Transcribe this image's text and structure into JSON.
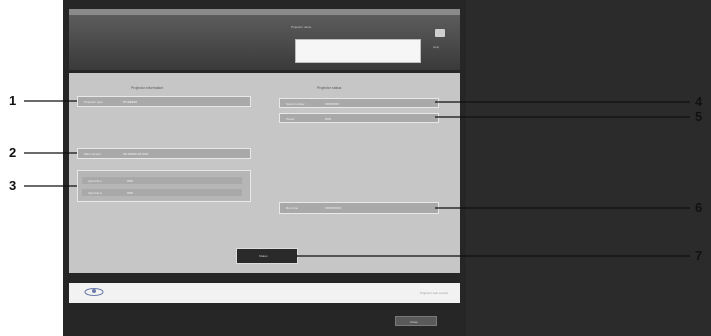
{
  "header": {
    "field_label": "Projector name",
    "icon_label": "Help"
  },
  "product_info": {
    "title": "Projector information",
    "projector_type": {
      "label": "Projector type",
      "value": "PT-REZ10"
    },
    "main_version": {
      "label": "Main version",
      "value": "XX.XX/XX.XX.XXX"
    },
    "input_rows": [
      {
        "label": "Input No.1",
        "value": "XXX"
      },
      {
        "label": "Input No.2",
        "value": "XXX"
      }
    ]
  },
  "product_status": {
    "title": "Projector status",
    "serial_number": {
      "label": "Serial number",
      "value": "XXXXXXX"
    },
    "power": {
      "label": "Power",
      "value": "XXX"
    },
    "run_time": {
      "label": "Run time",
      "value": "XXXXXXXX"
    }
  },
  "buttons": {
    "main": "Status",
    "bottom": "Close"
  },
  "footer": {
    "text": "Projector web control"
  },
  "callouts": [
    "1",
    "2",
    "3",
    "4",
    "5",
    "6",
    "7"
  ]
}
